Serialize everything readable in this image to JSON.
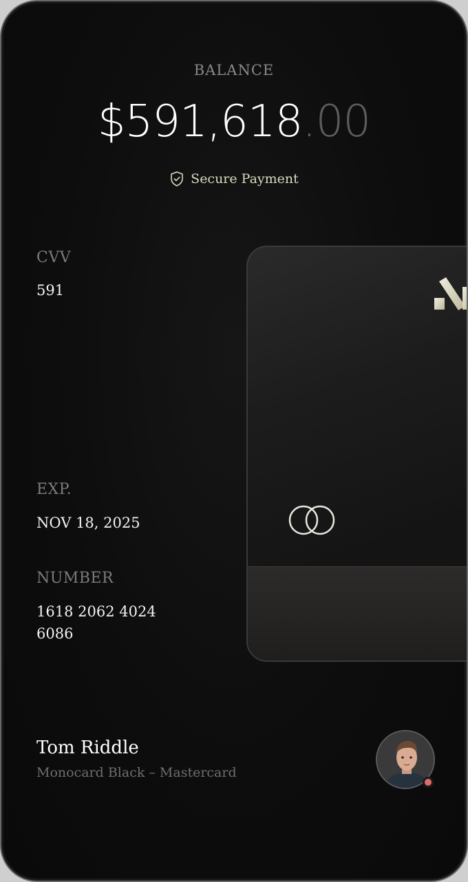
{
  "balance": {
    "label": "BALANCE",
    "whole": "$591,618",
    "cents": ".00"
  },
  "secure_label": "Secure Payment",
  "cvv": {
    "label": "CVV",
    "value": "591"
  },
  "exp": {
    "label": "EXP.",
    "value": "NOV 18, 2025"
  },
  "number": {
    "label": "NUMBER",
    "value": "1618 2062 4024 6086"
  },
  "holder": {
    "name": "Tom Riddle",
    "card_type": "Monocard Black – Mastercard",
    "status_color": "#e46a6a"
  },
  "icons": {
    "secure": "shield-check-icon",
    "brand": "monocard-logo",
    "network": "mastercard-logo"
  },
  "colors": {
    "background": "#0d0d0d",
    "accent": "#d9dcc0",
    "muted": "#7b7b7b"
  }
}
